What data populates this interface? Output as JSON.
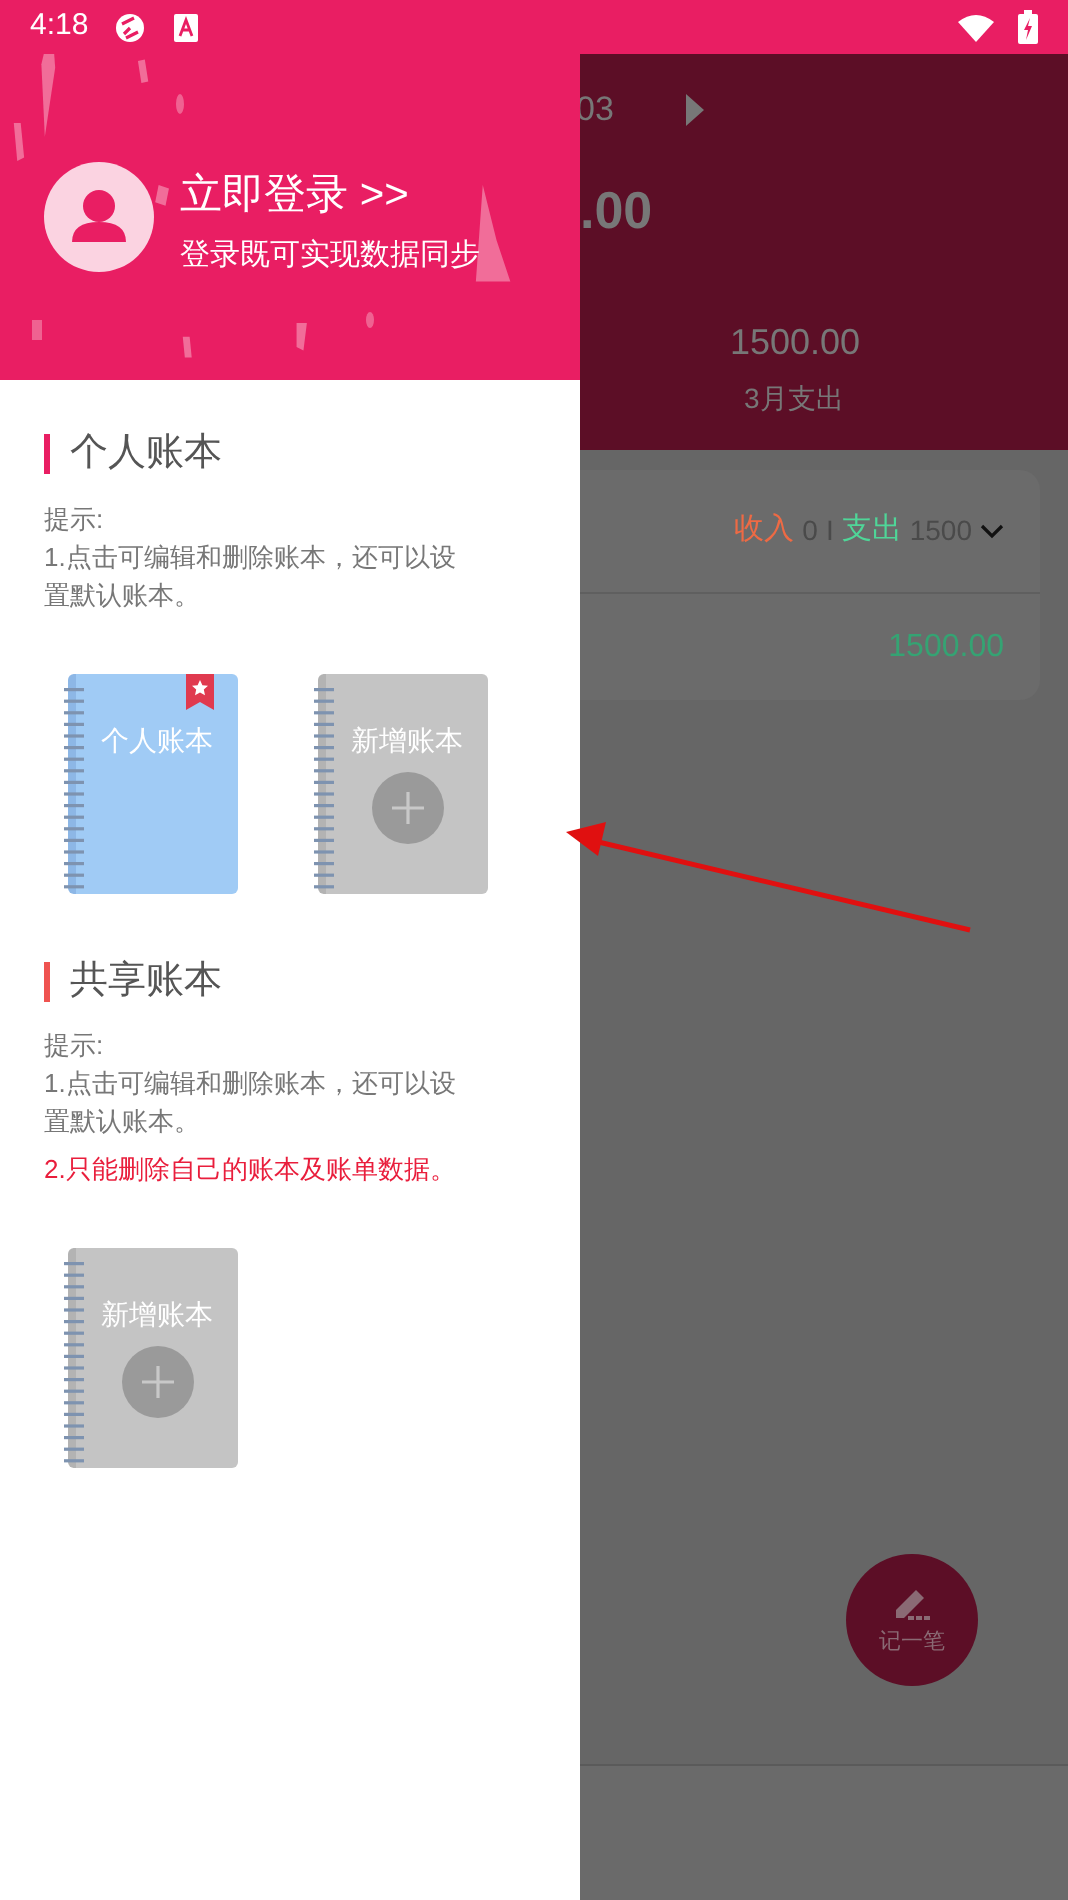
{
  "status_bar": {
    "time": "4:18"
  },
  "drawer": {
    "login": {
      "title": "立即登录 >>",
      "subtitle": "登录既可实现数据同步"
    },
    "sections": [
      {
        "title": "个人账本",
        "color": "#e91e63",
        "hint_label": "提示:",
        "hints": [
          {
            "text": "1.点击可编辑和删除账本，还可以设置默认账本。",
            "warning": false
          }
        ],
        "books": [
          {
            "kind": "book",
            "label": "个人账本",
            "default": true
          },
          {
            "kind": "add",
            "label": "新增账本"
          }
        ]
      },
      {
        "title": "共享账本",
        "color": "#ef5350",
        "hint_label": "提示:",
        "hints": [
          {
            "text": "1.点击可编辑和删除账本，还可以设置默认账本。",
            "warning": false
          },
          {
            "text": "2.只能删除自己的账本及账单数据。",
            "warning": true
          }
        ],
        "books": [
          {
            "kind": "add",
            "label": "新增账本"
          }
        ]
      }
    ]
  },
  "background": {
    "month_partial": "03",
    "total_partial": ".00",
    "expense": "1500.00",
    "expense_label": "3月支出",
    "summary": {
      "income_label": "收入",
      "income": "0",
      "separator": "I",
      "expense_label": "支出",
      "expense": "1500"
    },
    "row_amount": "1500.00",
    "fab_label": "记一笔"
  }
}
